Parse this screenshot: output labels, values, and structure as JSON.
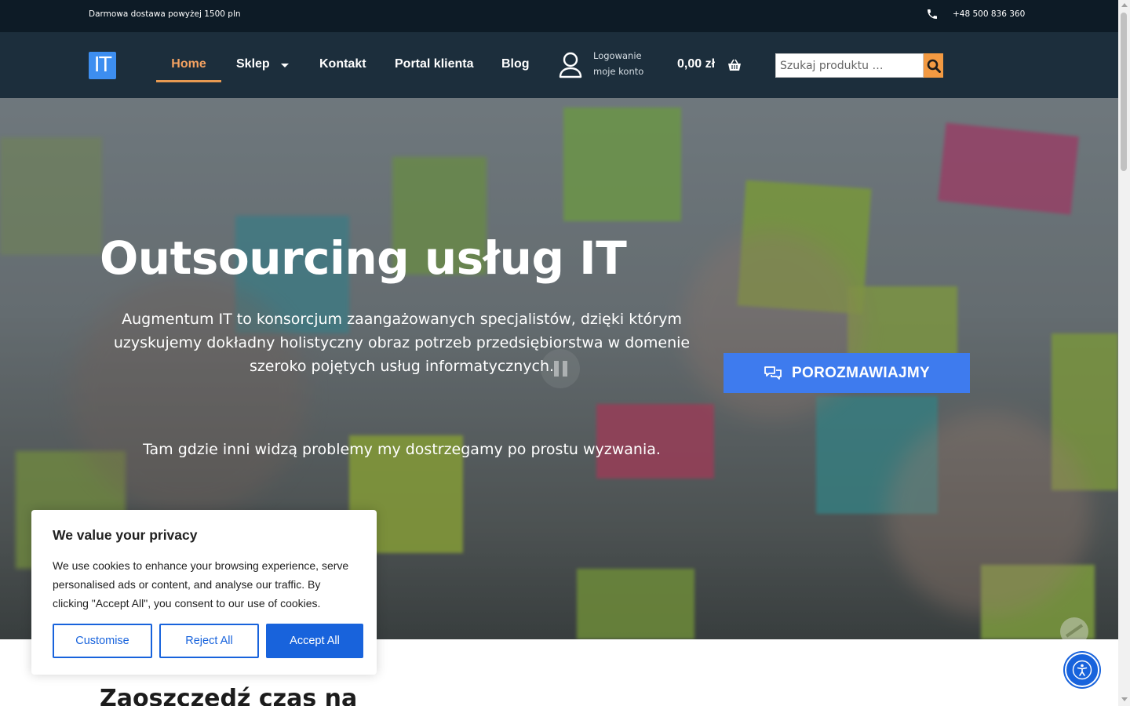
{
  "topbar": {
    "shipping_text": "Darmowa dostawa powyżej 1500 pln",
    "phone": "+48 500 836 360"
  },
  "header": {
    "logo_text": "IT",
    "nav": {
      "home": "Home",
      "shop": "Sklep",
      "contact": "Kontakt",
      "portal": "Portal klienta",
      "blog": "Blog"
    },
    "account": {
      "login": "Logowanie",
      "my_account": "moje konto"
    },
    "cart_total": "0,00 zł",
    "search": {
      "placeholder": "Szukaj produktu …"
    }
  },
  "hero": {
    "title": "Outsourcing usług IT",
    "description": "Augmentum IT to konsorcjum zaangażowanych specjalistów, dzięki którym uzyskujemy dokładny holistyczny obraz potrzeb przedsiębiorstwa w domenie szeroko pojętych usług informatycznych.",
    "tagline": "Tam gdzie inni widzą problemy my dostrzegamy po prostu wyzwania.",
    "cta_label": "POROZMAWIAJMY"
  },
  "next_section": {
    "heading": "Zaoszczędź czas na"
  },
  "cookie_banner": {
    "title": "We value your privacy",
    "text": "We use cookies to enhance your browsing experience, serve personalised ads or content, and analyse our traffic. By clicking \"Accept All\", you consent to our use of cookies.",
    "customise": "Customise",
    "reject": "Reject All",
    "accept": "Accept All"
  },
  "colors": {
    "topbar_bg": "#0d1b26",
    "navbar_bg": "#1c2e3c",
    "accent_orange": "#f39a42",
    "cta_blue": "#3e7bee",
    "cookie_blue": "#1863dc",
    "logo_blue": "#3d8ef0"
  }
}
